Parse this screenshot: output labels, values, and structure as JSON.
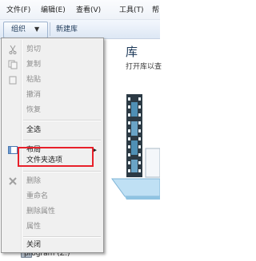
{
  "menubar": {
    "items": [
      "文件(F)",
      "编辑(E)",
      "查看(V)",
      "工具(T)",
      "帮"
    ]
  },
  "toolbar": {
    "organize_label": "组织",
    "organize_arrow": "▼",
    "new_library_label": "新建库"
  },
  "content": {
    "title": "库",
    "subtitle": "打开库以查"
  },
  "tree_peek": {
    "label": "program (Z:)"
  },
  "menu": {
    "items": [
      {
        "label": "剪切",
        "disabled": true,
        "icon": "scissors-icon"
      },
      {
        "label": "复制",
        "disabled": true,
        "icon": "copy-icon"
      },
      {
        "label": "粘贴",
        "disabled": true,
        "icon": "paste-icon"
      },
      {
        "label": "撤消",
        "disabled": true
      },
      {
        "label": "恢复",
        "disabled": true
      },
      {
        "label": "全选",
        "disabled": false
      },
      {
        "label": "布局",
        "disabled": false,
        "icon": "layout-icon",
        "submenu_arrow": "▶"
      },
      {
        "label": "文件夹选项",
        "disabled": false,
        "highlighted": true
      },
      {
        "label": "删除",
        "disabled": true,
        "icon": "delete-icon"
      },
      {
        "label": "重命名",
        "disabled": true
      },
      {
        "label": "删除属性",
        "disabled": true
      },
      {
        "label": "属性",
        "disabled": true
      },
      {
        "label": "关闭",
        "disabled": false
      }
    ]
  },
  "colors": {
    "highlight_border": "#e8202a",
    "disabled_text": "#8d8d8d",
    "title_color": "#1e3a5a"
  }
}
